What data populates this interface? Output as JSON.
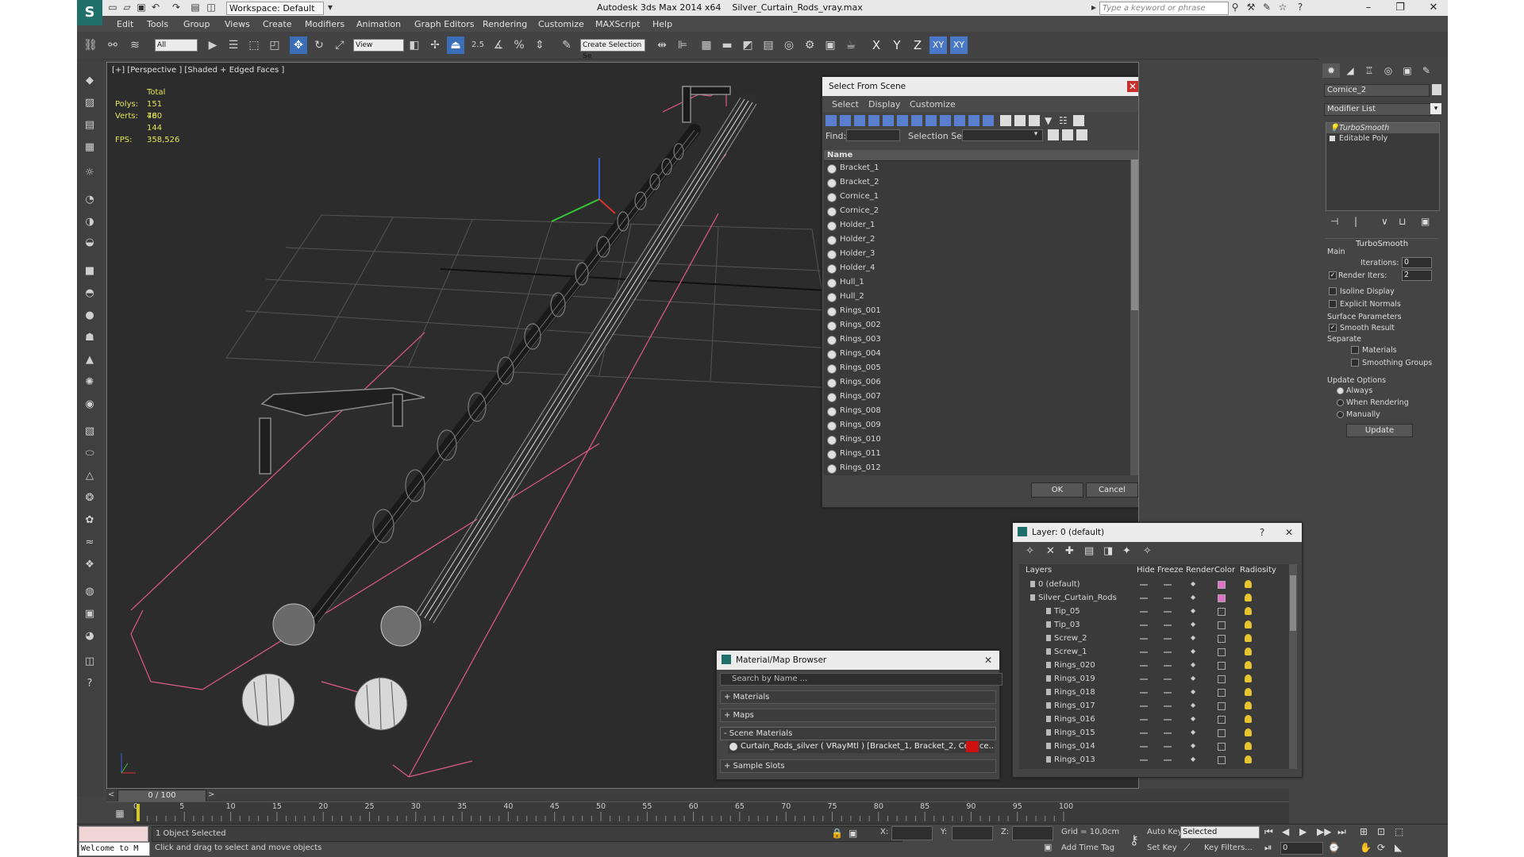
{
  "titlebar": {
    "workspace": "Workspace: Default",
    "app_title": "Autodesk 3ds Max  2014 x64",
    "file_name": "Silver_Curtain_Rods_vray.max",
    "search_placeholder": "Type a keyword or phrase"
  },
  "menu": [
    "Edit",
    "Tools",
    "Group",
    "Views",
    "Create",
    "Modifiers",
    "Animation",
    "Graph Editors",
    "Rendering",
    "Customize",
    "MAXScript",
    "Help"
  ],
  "toolbar": {
    "selection_filter": "All",
    "ref_coord": "View",
    "named_selection": "Create Selection Se",
    "snap_label": "2.5",
    "axes": [
      "X",
      "Y",
      "Z",
      "XY",
      "XY"
    ]
  },
  "viewport": {
    "label": "[+] [Perspective ] [Shaded + Edged Faces ]",
    "stats": {
      "total_label": "Total",
      "polys_label": "Polys:",
      "polys_value": "151 480",
      "verts_label": "Verts:",
      "verts_value": "76 144",
      "fps_label": "FPS:",
      "fps_value": "358,526"
    }
  },
  "command_panel": {
    "object_name": "Cornice_2",
    "modifier_list": "Modifier List",
    "stack": [
      "TurboSmooth",
      "Editable Poly"
    ],
    "rollout_title": "TurboSmooth",
    "main_label": "Main",
    "iterations_label": "Iterations:",
    "iterations_value": "0",
    "render_iters_label": "Render Iters:",
    "render_iters_value": "2",
    "isoline_label": "Isoline Display",
    "explicit_normals_label": "Explicit Normals",
    "surface_params_label": "Surface Parameters",
    "smooth_result_label": "Smooth Result",
    "separate_label": "Separate",
    "materials_label": "Materials",
    "smoothing_groups_label": "Smoothing Groups",
    "update_options_label": "Update Options",
    "always_label": "Always",
    "when_rendering_label": "When Rendering",
    "manually_label": "Manually",
    "update_button": "Update"
  },
  "select_from_scene": {
    "title": "Select From Scene",
    "menu": [
      "Select",
      "Display",
      "Customize"
    ],
    "find_label": "Find:",
    "selection_set_label": "Selection Set:",
    "column_name": "Name",
    "items": [
      "Bracket_1",
      "Bracket_2",
      "Cornice_1",
      "Cornice_2",
      "Holder_1",
      "Holder_2",
      "Holder_3",
      "Holder_4",
      "Hull_1",
      "Hull_2",
      "Rings_001",
      "Rings_002",
      "Rings_003",
      "Rings_004",
      "Rings_005",
      "Rings_006",
      "Rings_007",
      "Rings_008",
      "Rings_009",
      "Rings_010",
      "Rings_011",
      "Rings_012"
    ],
    "ok": "OK",
    "cancel": "Cancel"
  },
  "layer_dialog": {
    "title": "Layer: 0 (default)",
    "help": "?",
    "columns": [
      "Layers",
      "Hide",
      "Freeze",
      "Render",
      "Color",
      "Radiosity"
    ],
    "rows": [
      "0 (default)",
      "Silver_Curtain_Rods",
      "Tip_05",
      "Tip_03",
      "Screw_2",
      "Screw_1",
      "Rings_020",
      "Rings_019",
      "Rings_018",
      "Rings_017",
      "Rings_016",
      "Rings_015",
      "Rings_014",
      "Rings_013"
    ],
    "colors": [
      "#e070c8",
      "#e070c8",
      "#3a3a3a",
      "#3a3a3a",
      "#3a3a3a",
      "#3a3a3a",
      "#3a3a3a",
      "#3a3a3a",
      "#3a3a3a",
      "#3a3a3a",
      "#3a3a3a",
      "#3a3a3a",
      "#3a3a3a",
      "#3a3a3a"
    ]
  },
  "material_browser": {
    "title": "Material/Map Browser",
    "search_placeholder": "Search by Name ...",
    "materials": "+ Materials",
    "maps": "+ Maps",
    "scene_materials": "- Scene Materials",
    "scene_material_item": "Curtain_Rods_silver  ( VRayMtl )  [Bracket_1, Bracket_2, Cornice...",
    "sample_slots": "+ Sample Slots"
  },
  "timeline": {
    "frame": "0 / 100",
    "ticks": [
      "0",
      "5",
      "10",
      "15",
      "20",
      "25",
      "30",
      "35",
      "40",
      "45",
      "50",
      "55",
      "60",
      "65",
      "70",
      "75",
      "80",
      "85",
      "90",
      "95",
      "100"
    ]
  },
  "status": {
    "welcome": "Welcome to M",
    "selected": "1 Object Selected",
    "prompt": "Click and drag to select and move objects",
    "x_label": "X:",
    "y_label": "Y:",
    "z_label": "Z:",
    "grid": "Grid = 10,0cm",
    "add_time_tag": "Add Time Tag",
    "auto_key": "Auto Key",
    "set_key": "Set Key",
    "key_mode": "Selected",
    "key_filters": "Key Filters...",
    "current_frame": "0"
  },
  "colors": {
    "accent": "#3a6fb8",
    "stats_text": "#e5e55a",
    "viewport_bg": "#2c2c2c",
    "selection_box": "#e05a8a"
  }
}
